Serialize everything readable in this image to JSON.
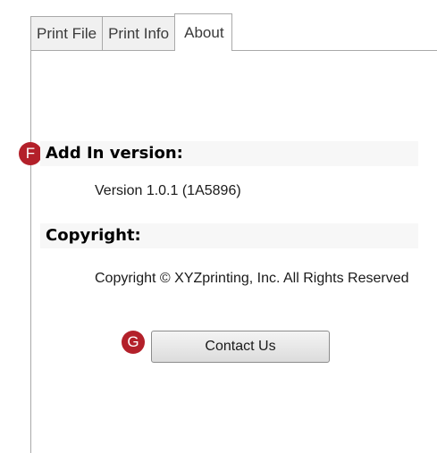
{
  "tabs": [
    {
      "label": "Print File",
      "active": false
    },
    {
      "label": "Print Info",
      "active": false
    },
    {
      "label": "About",
      "active": true
    }
  ],
  "about": {
    "version_heading": "Add In version:",
    "version_value": "Version 1.0.1 (1A5896)",
    "copyright_heading": "Copyright:",
    "copyright_value": "Copyright © XYZprinting, Inc. All Rights Reserved",
    "contact_button": "Contact Us"
  },
  "annotations": {
    "badge_f": "F",
    "badge_g": "G"
  },
  "colors": {
    "badge": "#b3202a",
    "heading_band": "#f7f7f7",
    "tab_inactive": "#f0f0f0"
  }
}
